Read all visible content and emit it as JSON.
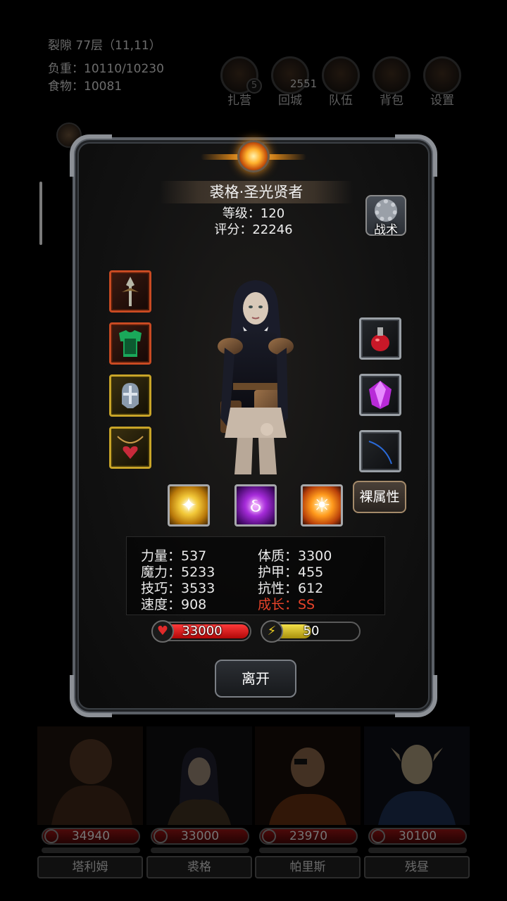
{
  "status": {
    "location": "裂隙 77层（11,11）",
    "load": "负重：10110/10230",
    "food": "食物：10081"
  },
  "topnav": {
    "camp": "扎营",
    "camp_badge": "5",
    "gold": "2551",
    "town": "回城",
    "team": "队伍",
    "bag": "背包",
    "settings": "设置"
  },
  "hero": {
    "name": "裘格·圣光贤者",
    "level": "等级：120",
    "score": "评分：22246",
    "tactic": "战术",
    "raw_attr": "裸属性"
  },
  "stats": {
    "str": "力量：537",
    "con": "体质：3300",
    "mag": "魔力：5233",
    "arm": "护甲：455",
    "skl": "技巧：3533",
    "res": "抗性：612",
    "spd": "速度：908",
    "grow": "成长：SS"
  },
  "bars": {
    "hp": "33000",
    "energy": "50",
    "hp_fill": 1.0,
    "energy_fill": 0.5
  },
  "leave": "离开",
  "party": [
    {
      "name": "塔利姆",
      "hp": "34940"
    },
    {
      "name": "裘格",
      "hp": "33000"
    },
    {
      "name": "帕里斯",
      "hp": "23970"
    },
    {
      "name": "残昼",
      "hp": "30100"
    }
  ],
  "icons": {
    "left_slots": [
      "spear-icon",
      "armor-icon",
      "helmet-icon",
      "amulet-icon"
    ],
    "right_slots": [
      "potion-icon",
      "gem-icon",
      "whip-icon"
    ],
    "skills": [
      "holy-burst-icon",
      "arcane-rune-icon",
      "divine-fire-icon"
    ]
  },
  "colors": {
    "growth": "#e8432a",
    "hp": "#d01010",
    "energy": "#d8c020"
  }
}
